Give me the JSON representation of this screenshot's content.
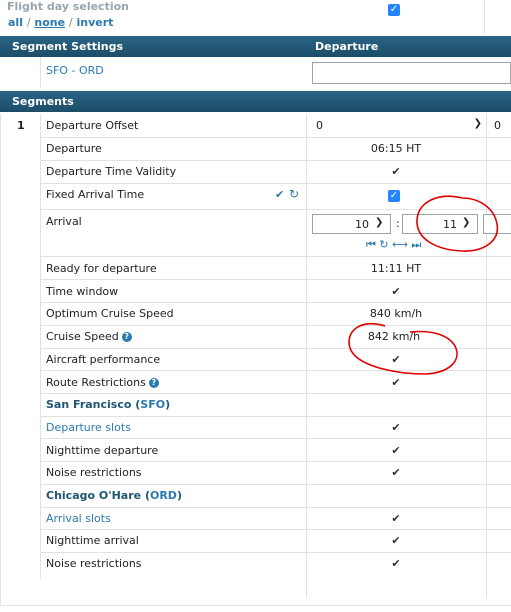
{
  "flight_day": {
    "title": "Flight day selection",
    "links": {
      "all": "all",
      "none": "none",
      "invert": "invert"
    },
    "separator": "/"
  },
  "segment_settings": {
    "header": "Segment Settings",
    "column": "Departure",
    "route_from": "SFO",
    "route_dash": "-",
    "route_to": "ORD"
  },
  "segments": {
    "header": "Segments",
    "index": "1",
    "departure_offset_label": "Departure Offset",
    "departure_offset_value": "0",
    "departure_offset_next": "0",
    "departure_label": "Departure",
    "departure_value": "06:15 HT",
    "validity_label": "Departure Time Validity",
    "fixed_arrival_label": "Fixed Arrival Time",
    "arrival_label": "Arrival",
    "arrival_hour": "10",
    "arrival_colon": ":",
    "arrival_minute": "11",
    "ready_label": "Ready for departure",
    "ready_value": "11:11 HT",
    "time_window_label": "Time window",
    "optimum_speed_label": "Optimum Cruise Speed",
    "optimum_speed_value": "840 km/h",
    "cruise_speed_label": "Cruise Speed",
    "cruise_speed_value": "842 km/h",
    "aircraft_perf_label": "Aircraft performance",
    "route_restrictions_label": "Route Restrictions"
  },
  "origin": {
    "city": "San Francisco",
    "code": "SFO",
    "slots_label": "Departure slots",
    "night_label": "Nighttime departure",
    "noise_label": "Noise restrictions"
  },
  "destination": {
    "city": "Chicago O'Hare",
    "code": "ORD",
    "slots_label": "Arrival slots",
    "night_label": "Nighttime arrival",
    "noise_label": "Noise restrictions"
  },
  "colors": {
    "header_bg": "#1f5673",
    "link": "#2a7ab0",
    "checkbox": "#2684ff",
    "annotation": "#e00000"
  },
  "icons": {
    "check": "check-icon",
    "help": "help-icon",
    "chevron": "chevron-down-icon",
    "reset": "undo-icon"
  }
}
